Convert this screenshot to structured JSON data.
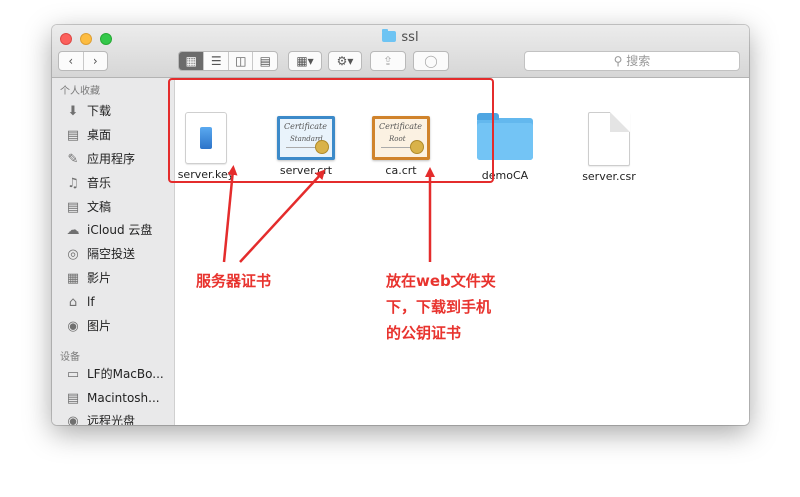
{
  "window": {
    "title": "ssl"
  },
  "toolbar": {
    "back_icon": "chevron-left-icon",
    "forward_icon": "chevron-right-icon",
    "view_modes": [
      "icon-view",
      "list-view",
      "column-view",
      "coverflow-view"
    ],
    "search_placeholder": "搜索"
  },
  "sidebar": {
    "favorites_header": "个人收藏",
    "favorites": [
      {
        "label": "下载",
        "icon": "download-icon"
      },
      {
        "label": "桌面",
        "icon": "desktop-icon"
      },
      {
        "label": "应用程序",
        "icon": "applications-icon"
      },
      {
        "label": "音乐",
        "icon": "music-icon"
      },
      {
        "label": "文稿",
        "icon": "documents-icon"
      },
      {
        "label": "iCloud 云盘",
        "icon": "cloud-icon"
      },
      {
        "label": "隔空投送",
        "icon": "airdrop-icon"
      },
      {
        "label": "影片",
        "icon": "movies-icon"
      },
      {
        "label": "lf",
        "icon": "home-icon"
      },
      {
        "label": "图片",
        "icon": "camera-icon"
      }
    ],
    "devices_header": "设备",
    "devices": [
      {
        "label": "LF的MacBo...",
        "icon": "laptop-icon"
      },
      {
        "label": "Macintosh...",
        "icon": "disk-icon"
      },
      {
        "label": "远程光盘",
        "icon": "optical-disc-icon"
      }
    ]
  },
  "files": [
    {
      "name": "server.key",
      "icon": "key-file-icon"
    },
    {
      "name": "server.crt",
      "icon": "certificate-icon",
      "cert_text": "Certificate",
      "cert_sub": "Standard"
    },
    {
      "name": "ca.crt",
      "icon": "certificate-icon",
      "cert_text": "Certificate",
      "cert_sub": "Root"
    },
    {
      "name": "demoCA",
      "icon": "folder-icon"
    },
    {
      "name": "server.csr",
      "icon": "document-icon"
    }
  ],
  "annotations": {
    "left_label": "服务器证书",
    "right_lines": [
      "放在web文件夹",
      "下，下载到手机",
      "的公钥证书"
    ],
    "color": "#e8332e"
  }
}
